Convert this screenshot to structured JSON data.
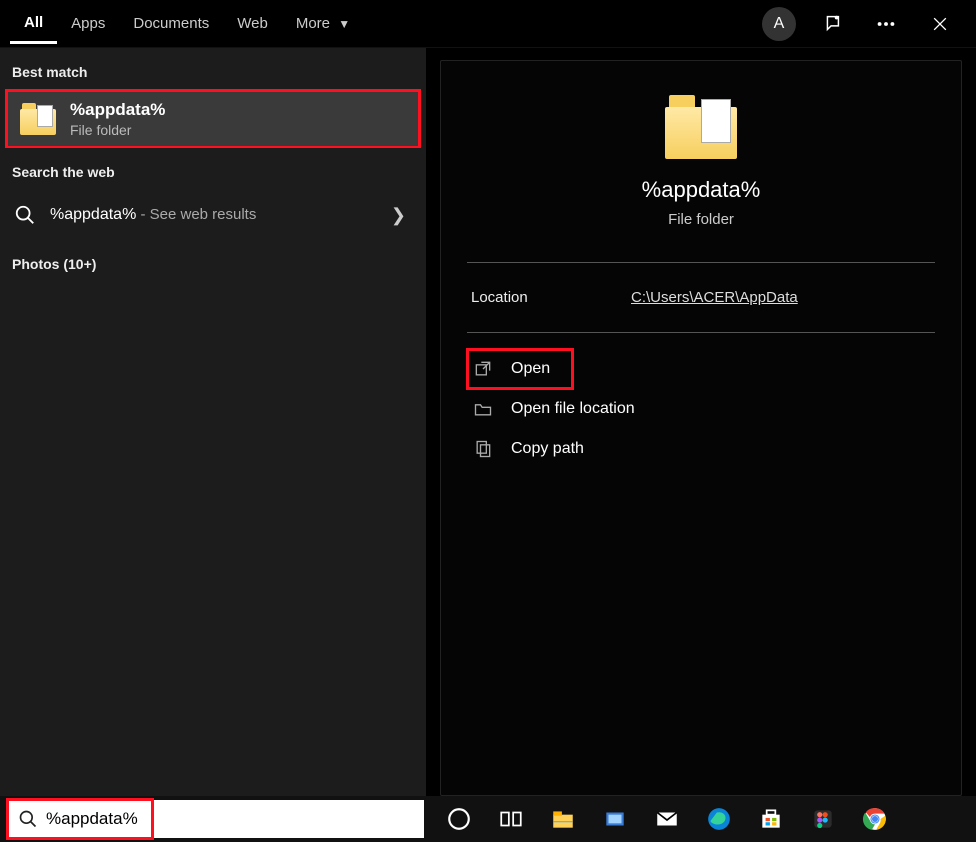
{
  "tabs": {
    "all": "All",
    "apps": "Apps",
    "documents": "Documents",
    "web": "Web",
    "more": "More"
  },
  "avatar_initial": "A",
  "sections": {
    "best_match": "Best match",
    "search_web": "Search the web",
    "photos": "Photos (10+)"
  },
  "best_match": {
    "title": "%appdata%",
    "subtitle": "File folder"
  },
  "web_result": {
    "query": "%appdata%",
    "hint": " - See web results"
  },
  "preview": {
    "title": "%appdata%",
    "subtitle": "File folder",
    "location_label": "Location",
    "location_value": "C:\\Users\\ACER\\AppData",
    "actions": {
      "open": "Open",
      "open_loc": "Open file location",
      "copy_path": "Copy path"
    }
  },
  "searchbox": {
    "value": "%appdata%"
  }
}
